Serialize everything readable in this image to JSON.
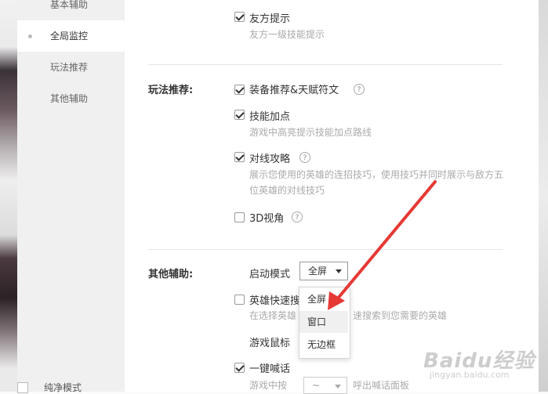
{
  "sidebar": {
    "items": [
      {
        "label": "基本辅助"
      },
      {
        "label": "全局监控"
      },
      {
        "label": "玩法推荐"
      },
      {
        "label": "其他辅助"
      }
    ],
    "bottom_label": "纯净模式"
  },
  "top_option": {
    "label": "友方提示",
    "desc": "友方一级技能提示",
    "checked": true
  },
  "play_section": {
    "title": "玩法推荐:",
    "options": [
      {
        "label": "装备推荐&天赋符文",
        "checked": true,
        "help": "?"
      },
      {
        "label": "技能加点",
        "checked": true,
        "desc": "游戏中高亮提示技能加点路线"
      },
      {
        "label": "对线攻略",
        "checked": true,
        "help": "?",
        "desc": "展示您使用的英雄的连招技巧，使用技巧并同时展示与敌方五位英雄的对线技巧"
      },
      {
        "label": "3D视角",
        "checked": false,
        "help": "?"
      }
    ]
  },
  "other_section": {
    "title": "其他辅助:",
    "launch_mode_label": "启动模式",
    "launch_mode_value": "全屏",
    "dropdown_options": [
      "全屏",
      "窗口",
      "无边框"
    ],
    "hero_search_label": "英雄快速搜",
    "hero_search_desc_a": "在选择英雄",
    "hero_search_desc_b": "速搜索到您需要的英雄",
    "mouse_label": "游戏鼠标",
    "shout_label": "一键喊话",
    "shout_desc_a": "游戏中按",
    "shout_desc_b": "呼出喊话面板",
    "shout_key_value": "~"
  },
  "watermark": {
    "text": "Baidu经验",
    "sub": "jingyan.baidu.com"
  },
  "colors": {
    "arrow": "#e53935",
    "sidebar_bg": "#f0f0f0",
    "main_bg": "#ffffff"
  }
}
